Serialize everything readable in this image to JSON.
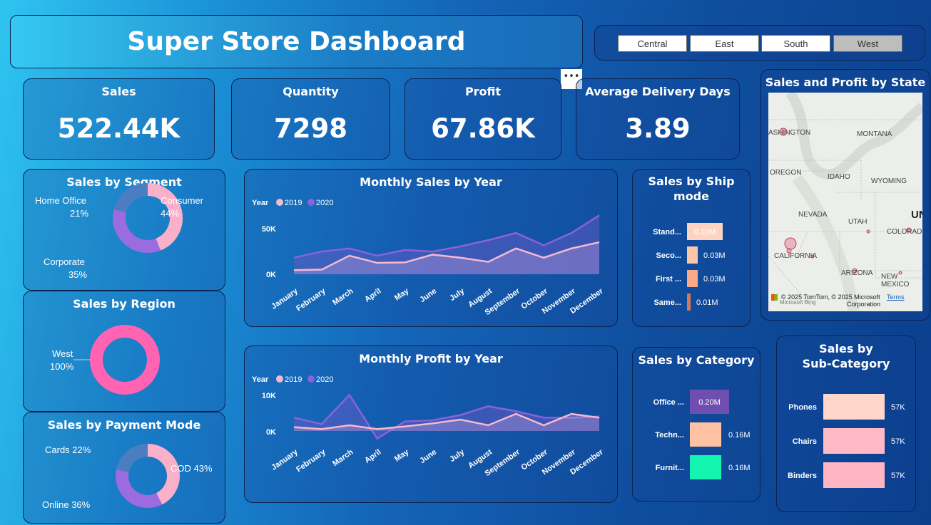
{
  "title": "Super Store Dashboard",
  "regions": [
    "Central",
    "East",
    "South",
    "West"
  ],
  "selected_region": "West",
  "more_label": "•••",
  "kpis": {
    "sales": {
      "label": "Sales",
      "value": "522.44K"
    },
    "quantity": {
      "label": "Quantity",
      "value": "7298"
    },
    "profit": {
      "label": "Profit",
      "value": "67.86K"
    },
    "delivery": {
      "label": "Average Delivery Days",
      "value": "3.89"
    }
  },
  "segment": {
    "title": "Sales by Segment",
    "items": [
      {
        "name": "Home Office",
        "pct": "21%"
      },
      {
        "name": "Consumer",
        "pct": "44%"
      },
      {
        "name": "Corporate",
        "pct": "35%"
      }
    ]
  },
  "region_chart": {
    "title": "Sales by Region",
    "name": "West",
    "pct": "100%"
  },
  "payment": {
    "title": "Sales by Payment Mode",
    "cards": "Cards 22%",
    "cod": "COD 43%",
    "online": "Online 36%"
  },
  "monthly_sales": {
    "title": "Monthly Sales by Year",
    "legend_title": "Year",
    "y_ticks": [
      "50K",
      "0K"
    ]
  },
  "monthly_profit": {
    "title": "Monthly Profit by Year",
    "legend_title": "Year",
    "y_ticks": [
      "10K",
      "0K"
    ]
  },
  "ship": {
    "title": "Sales by Ship mode",
    "bars": [
      {
        "label": "Stand...",
        "value": "0.10M"
      },
      {
        "label": "Seco...",
        "value": "0.03M"
      },
      {
        "label": "First ...",
        "value": "0.03M"
      },
      {
        "label": "Same...",
        "value": "0.01M"
      }
    ]
  },
  "category": {
    "title": "Sales by Category",
    "bars": [
      {
        "label": "Office ...",
        "value": "0.20M"
      },
      {
        "label": "Techn...",
        "value": "0.16M"
      },
      {
        "label": "Furnit...",
        "value": "0.16M"
      }
    ]
  },
  "subcat": {
    "title_line1": "Sales by",
    "title_line2": "Sub-Category",
    "bars": [
      {
        "label": "Phones",
        "value": "57K"
      },
      {
        "label": "Chairs",
        "value": "57K"
      },
      {
        "label": "Binders",
        "value": "57K"
      }
    ]
  },
  "map": {
    "title": "Sales and Profit by State",
    "labels": [
      "ASHINGTON",
      "MONTANA",
      "OREGON",
      "IDAHO",
      "WYOMING",
      "NEVADA",
      "UTAH",
      "COLORADO",
      "CALIFORNIA",
      "ARIZONA",
      "NEW MEXICO",
      "UN"
    ],
    "credit1": "© 2025 TomTom, © 2025 Microsoft",
    "credit2": "Corporation",
    "terms": "Terms",
    "bing": "Microsoft Bing"
  },
  "chart_data": [
    {
      "type": "line",
      "title": "Monthly Sales by Year",
      "categories": [
        "January",
        "February",
        "March",
        "April",
        "May",
        "June",
        "July",
        "August",
        "September",
        "October",
        "November",
        "December"
      ],
      "series": [
        {
          "name": "2019",
          "values": [
            4000,
            4500,
            18000,
            11000,
            11500,
            19000,
            16000,
            12000,
            25000,
            16000,
            25000,
            31000
          ]
        },
        {
          "name": "2020",
          "values": [
            16000,
            22000,
            25000,
            18000,
            23500,
            22000,
            27000,
            33000,
            40000,
            28000,
            40000,
            57000
          ]
        }
      ],
      "ylim": [
        0,
        60000
      ],
      "y_ticks": [
        "50K",
        "0K"
      ],
      "legend_title": "Year",
      "colors": {
        "2019": "#f7b9cf",
        "2020": "#8a62d9"
      }
    },
    {
      "type": "line",
      "title": "Monthly Profit by Year",
      "categories": [
        "January",
        "February",
        "March",
        "April",
        "May",
        "June",
        "July",
        "August",
        "September",
        "October",
        "November",
        "December"
      ],
      "series": [
        {
          "name": "2019",
          "values": [
            1000,
            500,
            1500,
            500,
            1200,
            2000,
            3000,
            1500,
            4500,
            1500,
            4500,
            3500
          ]
        },
        {
          "name": "2020",
          "values": [
            3500,
            1800,
            9500,
            -2000,
            2500,
            2800,
            4200,
            6500,
            5200,
            3500,
            3500,
            3800
          ]
        }
      ],
      "ylim": [
        -3000,
        12000
      ],
      "y_ticks": [
        "10K",
        "0K"
      ],
      "legend_title": "Year",
      "colors": {
        "2019": "#f7b9cf",
        "2020": "#8a62d9"
      }
    },
    {
      "type": "bar",
      "title": "Sales by Ship mode",
      "categories": [
        "Stand...",
        "Seco...",
        "First ...",
        "Same..."
      ],
      "values": [
        0.1,
        0.03,
        0.03,
        0.01
      ],
      "unit": "M"
    },
    {
      "type": "bar",
      "title": "Sales by Category",
      "categories": [
        "Office ...",
        "Techn...",
        "Furnit..."
      ],
      "values": [
        0.2,
        0.16,
        0.16
      ],
      "unit": "M"
    },
    {
      "type": "bar",
      "title": "Sales by Sub-Category",
      "categories": [
        "Phones",
        "Chairs",
        "Binders"
      ],
      "values": [
        57,
        57,
        57
      ],
      "unit": "K"
    },
    {
      "type": "pie",
      "title": "Sales by Segment",
      "categories": [
        "Consumer",
        "Corporate",
        "Home Office"
      ],
      "values": [
        44,
        35,
        21
      ]
    },
    {
      "type": "pie",
      "title": "Sales by Region",
      "categories": [
        "West"
      ],
      "values": [
        100
      ]
    },
    {
      "type": "pie",
      "title": "Sales by Payment Mode",
      "categories": [
        "COD",
        "Online",
        "Cards"
      ],
      "values": [
        43,
        36,
        22
      ]
    }
  ]
}
